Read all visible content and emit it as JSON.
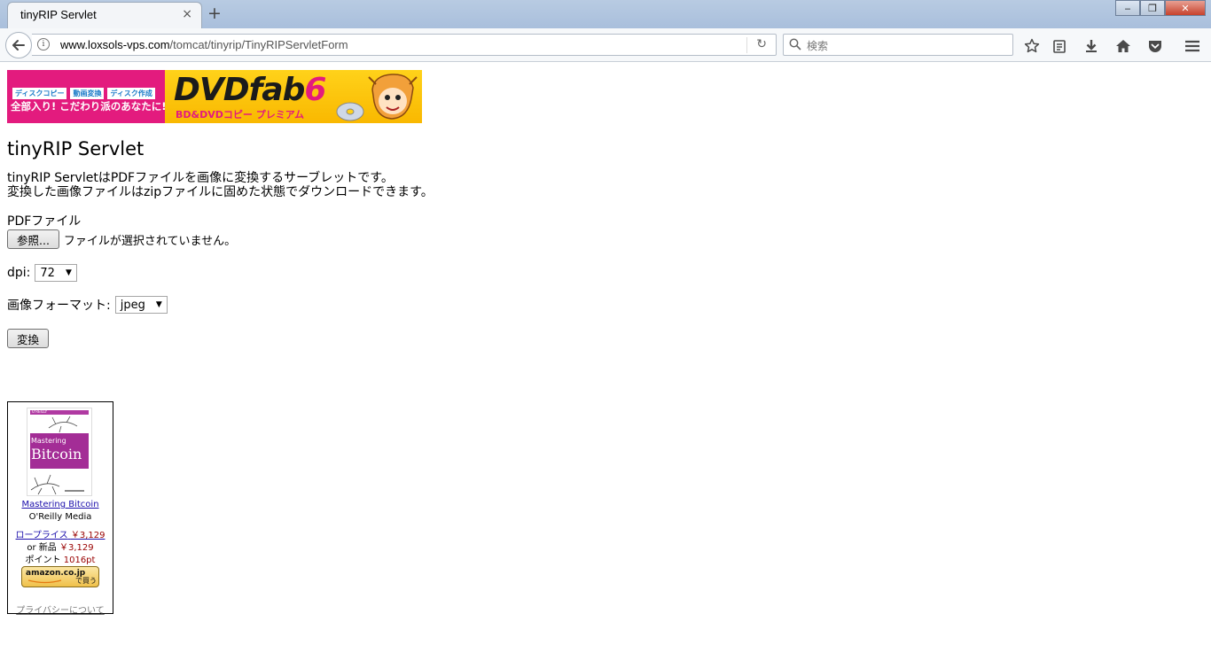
{
  "browser": {
    "tab_title": "tinyRIP Servlet",
    "tab_close": "×",
    "new_tab": "+",
    "url_domain": "www.loxsols-vps.com",
    "url_path": "/tomcat/tinyrip/TinyRIPServletForm",
    "search_placeholder": "検索",
    "window_buttons": {
      "minimize": "‒",
      "maximize": "❐",
      "close": "✕"
    }
  },
  "banner": {
    "tags": [
      "ディスクコピー",
      "動画変換",
      "ディスク作成"
    ],
    "slogan": "全部入り! こだわり派のあなたに!",
    "logo": "DVDfab",
    "logo_num": "6",
    "subtitle": "BD&DVDコピー プレミアム"
  },
  "page": {
    "title": "tinyRIP Servlet",
    "desc_line1": "tinyRIP ServletはPDFファイルを画像に変換するサーブレットです。",
    "desc_line2": "変換した画像ファイルはzipファイルに固めた状態でダウンロードできます。",
    "pdf_label": "PDFファイル",
    "browse_button": "参照...",
    "file_status": "ファイルが選択されていません。",
    "dpi_label": "dpi:",
    "dpi_value": "72",
    "format_label": "画像フォーマット:",
    "format_value": "jpeg",
    "convert_button": "変換"
  },
  "ad": {
    "book_publisher": "O'REILLY",
    "book_cover_title_small": "Mastering",
    "book_cover_title_large": "Bitcoin",
    "book_link": "Mastering Bitcoin",
    "publisher": "O'Reilly Media",
    "lowprice_label": "ロープライス",
    "lowprice_value": "￥3,129",
    "new_label": "or 新品",
    "new_value": "￥3,129",
    "points_label": "ポイント",
    "points_value": "1016pt",
    "buy_button_brand": "amazon.co.jp",
    "buy_button_text": "で買う",
    "privacy": "プライバシーについて"
  }
}
